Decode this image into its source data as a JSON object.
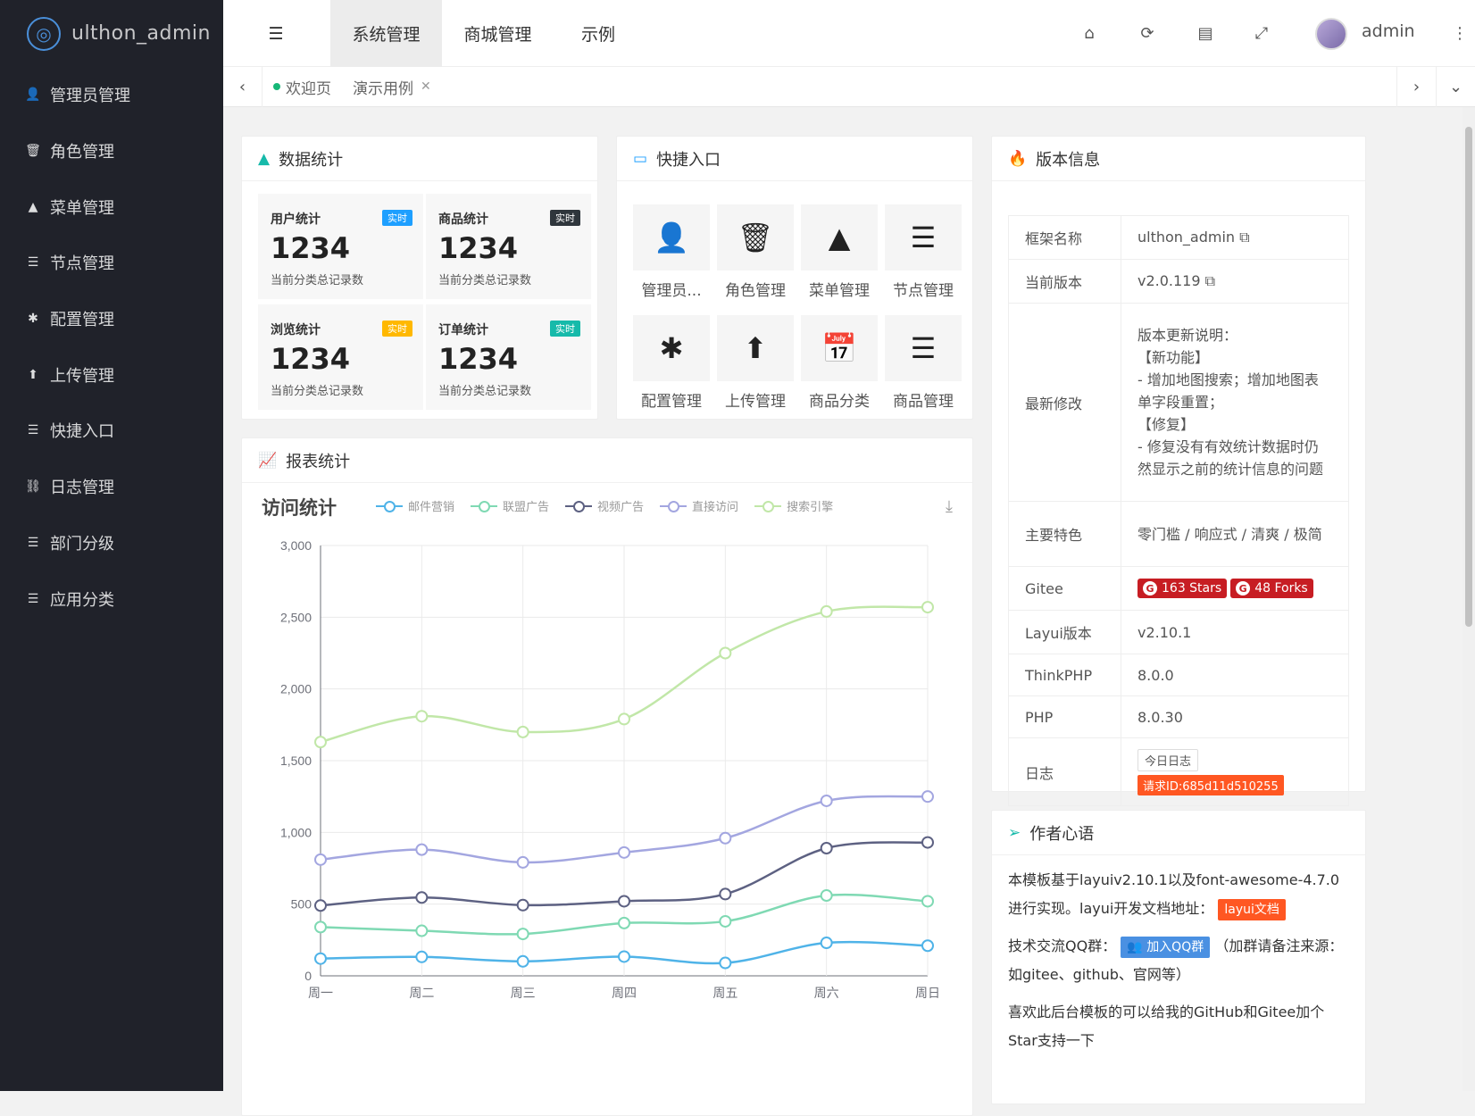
{
  "app": {
    "logo_text": "ulthon_admin"
  },
  "sidebar": {
    "items": [
      {
        "label": "管理员管理",
        "icon": "user-icon",
        "glyph": "👤"
      },
      {
        "label": "角色管理",
        "icon": "bucket-icon",
        "glyph": "🗑"
      },
      {
        "label": "菜单管理",
        "icon": "tree-icon",
        "glyph": "▲"
      },
      {
        "label": "节点管理",
        "icon": "list-icon",
        "glyph": "☰"
      },
      {
        "label": "配置管理",
        "icon": "asterisk-icon",
        "glyph": "✱"
      },
      {
        "label": "上传管理",
        "icon": "arrow-up-icon",
        "glyph": "⬆"
      },
      {
        "label": "快捷入口",
        "icon": "list-icon",
        "glyph": "☰"
      },
      {
        "label": "日志管理",
        "icon": "connect-icon",
        "glyph": "⛓"
      },
      {
        "label": "部门分级",
        "icon": "list-icon",
        "glyph": "☰"
      },
      {
        "label": "应用分类",
        "icon": "list-icon",
        "glyph": "☰"
      }
    ]
  },
  "topbar": {
    "modules": [
      "系统管理",
      "商城管理",
      "示例"
    ],
    "user": "admin",
    "icons": [
      "home-icon",
      "refresh-icon",
      "cache-icon",
      "lock-icon",
      "more-icon"
    ]
  },
  "tabs": {
    "items": [
      {
        "label": "欢迎页"
      },
      {
        "label": "演示用例"
      }
    ]
  },
  "stats": {
    "title": "数据统计",
    "cards": [
      {
        "title": "用户统计",
        "badge": "实时",
        "badge_color": "#1e9fff",
        "value": "1234",
        "desc": "当前分类总记录数"
      },
      {
        "title": "商品统计",
        "badge": "实时",
        "badge_color": "#2f363c",
        "value": "1234",
        "desc": "当前分类总记录数"
      },
      {
        "title": "浏览统计",
        "badge": "实时",
        "badge_color": "#ffb800",
        "value": "1234",
        "desc": "当前分类总记录数"
      },
      {
        "title": "订单统计",
        "badge": "实时",
        "badge_color": "#16baaa",
        "value": "1234",
        "desc": "当前分类总记录数"
      }
    ]
  },
  "quick": {
    "title": "快捷入口",
    "items": [
      {
        "label": "管理员...",
        "icon": "user-icon",
        "glyph": "👤"
      },
      {
        "label": "角色管理",
        "icon": "bucket-icon",
        "glyph": "🗑"
      },
      {
        "label": "菜单管理",
        "icon": "tree-icon",
        "glyph": "▲"
      },
      {
        "label": "节点管理",
        "icon": "list-icon",
        "glyph": "☰"
      },
      {
        "label": "配置管理",
        "icon": "asterisk-icon",
        "glyph": "✱"
      },
      {
        "label": "上传管理",
        "icon": "arrow-up-icon",
        "glyph": "⬆"
      },
      {
        "label": "商品分类",
        "icon": "calendar-check-icon",
        "glyph": "📅"
      },
      {
        "label": "商品管理",
        "icon": "list-icon",
        "glyph": "☰"
      }
    ]
  },
  "report": {
    "title": "报表统计"
  },
  "version": {
    "title": "版本信息",
    "rows": {
      "framework_k": "框架名称",
      "framework_v": "ulthon_admin",
      "current_k": "当前版本",
      "current_v": "v2.0.119",
      "latest_k": "最新修改",
      "latest_lines": [
        "版本更新说明：",
        "【新功能】",
        "- 增加地图搜索；增加地图表单字段重置；",
        "【修复】",
        "- 修复没有有效统计数据时仍然显示之前的统计信息的问题"
      ],
      "feature_k": "主要特色",
      "feature_v": "零门槛 / 响应式 / 清爽 / 极简",
      "gitee_k": "Gitee",
      "stars": "163 Stars",
      "forks": "48 Forks",
      "layui_k": "Layui版本",
      "layui_v": "v2.10.1",
      "tp_k": "ThinkPHP",
      "tp_v": "8.0.0",
      "php_k": "PHP",
      "php_v": "8.0.30",
      "log_k": "日志",
      "log_btn": "今日日志",
      "request_id": "请求ID:685d11d510255"
    }
  },
  "author": {
    "title": "作者心语",
    "p1": "本模板基于layuiv2.10.1以及font-awesome-4.7.0进行实现。layui开发文档地址：",
    "layui_doc": "layui文档",
    "p2_prefix": "技术交流QQ群：",
    "qq_btn": "加入QQ群",
    "p2_suffix": "（加群请备注来源：如gitee、github、官网等）",
    "p3": "喜欢此后台模板的可以给我的GitHub和Gitee加个Star支持一下"
  },
  "chart_data": {
    "type": "line",
    "title": "访问统计",
    "categories": [
      "周一",
      "周二",
      "周三",
      "周四",
      "周五",
      "周六",
      "周日"
    ],
    "ylim": [
      0,
      3000
    ],
    "yticks": [
      0,
      500,
      1000,
      1500,
      2000,
      2500,
      3000
    ],
    "ytick_labels": [
      "0",
      "500",
      "1,000",
      "1,500",
      "2,000",
      "2,500",
      "3,000"
    ],
    "legend_position": "top",
    "smooth": true,
    "series": [
      {
        "name": "邮件营销",
        "color": "#4fb3e8",
        "values": [
          120,
          132,
          101,
          134,
          90,
          230,
          210
        ]
      },
      {
        "name": "联盟广告",
        "color": "#7fd9b3",
        "values": [
          340,
          314,
          292,
          368,
          380,
          560,
          520
        ]
      },
      {
        "name": "视频广告",
        "color": "#5d6182",
        "values": [
          490,
          546,
          493,
          520,
          570,
          890,
          930
        ]
      },
      {
        "name": "直接访问",
        "color": "#a3a6e0",
        "values": [
          810,
          880,
          791,
          860,
          960,
          1220,
          1250
        ]
      },
      {
        "name": "搜索引擎",
        "color": "#c1e7a8",
        "values": [
          1630,
          1810,
          1700,
          1790,
          2250,
          2540,
          2570
        ]
      }
    ]
  }
}
